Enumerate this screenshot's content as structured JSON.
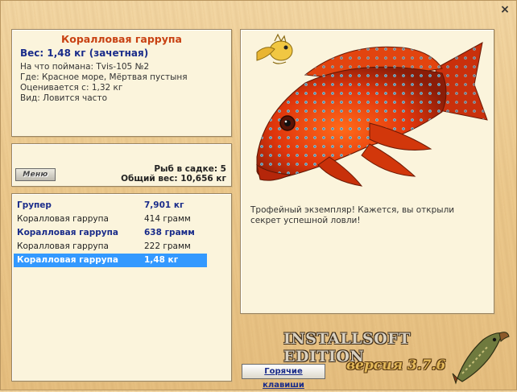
{
  "window": {
    "close_glyph": "×"
  },
  "info": {
    "fish_name": "Коралловая гаррупа",
    "weight_line": "Вес: 1,48 кг (зачетная)",
    "details": [
      "На что поймана: Tvis-105 №2",
      "Где: Красное море, Мёртвая пустыня",
      "Оценивается с: 1,32 кг",
      "Вид: Ловится часто"
    ]
  },
  "summary": {
    "menu_label": "Меню",
    "fish_in_keepnet": "Рыб в садке: 5",
    "total_weight": "Общий вес: 10,656 кг"
  },
  "catch_list": [
    {
      "name": "Групер",
      "weight": "7,901 кг",
      "style": "trophy"
    },
    {
      "name": "Коралловая гаррупа",
      "weight": "414 грамм",
      "style": "normal"
    },
    {
      "name": "Коралловая гаррупа",
      "weight": "638 грамм",
      "style": "trophy"
    },
    {
      "name": "Коралловая гаррупа",
      "weight": "222 грамм",
      "style": "normal"
    },
    {
      "name": "Коралловая гаррупа",
      "weight": "1,48 кг",
      "style": "selected"
    }
  ],
  "fish_panel": {
    "message": "Трофейный экземпляр! Кажется, вы открыли секрет успешной ловли!",
    "fish_icon": "coral-grouper-image",
    "trophy_icon": "golden-fish-badge-icon"
  },
  "footer": {
    "hotkeys_label": "Горячие клавиши",
    "edition_text": "INSTALLSOFT EDITION",
    "version_text": "версия 3.7.6",
    "logo_icon": "pike-logo-icon"
  },
  "colors": {
    "title_accent": "#c84112",
    "trophy_blue": "#1a2c8a",
    "selection": "#3399ff"
  }
}
